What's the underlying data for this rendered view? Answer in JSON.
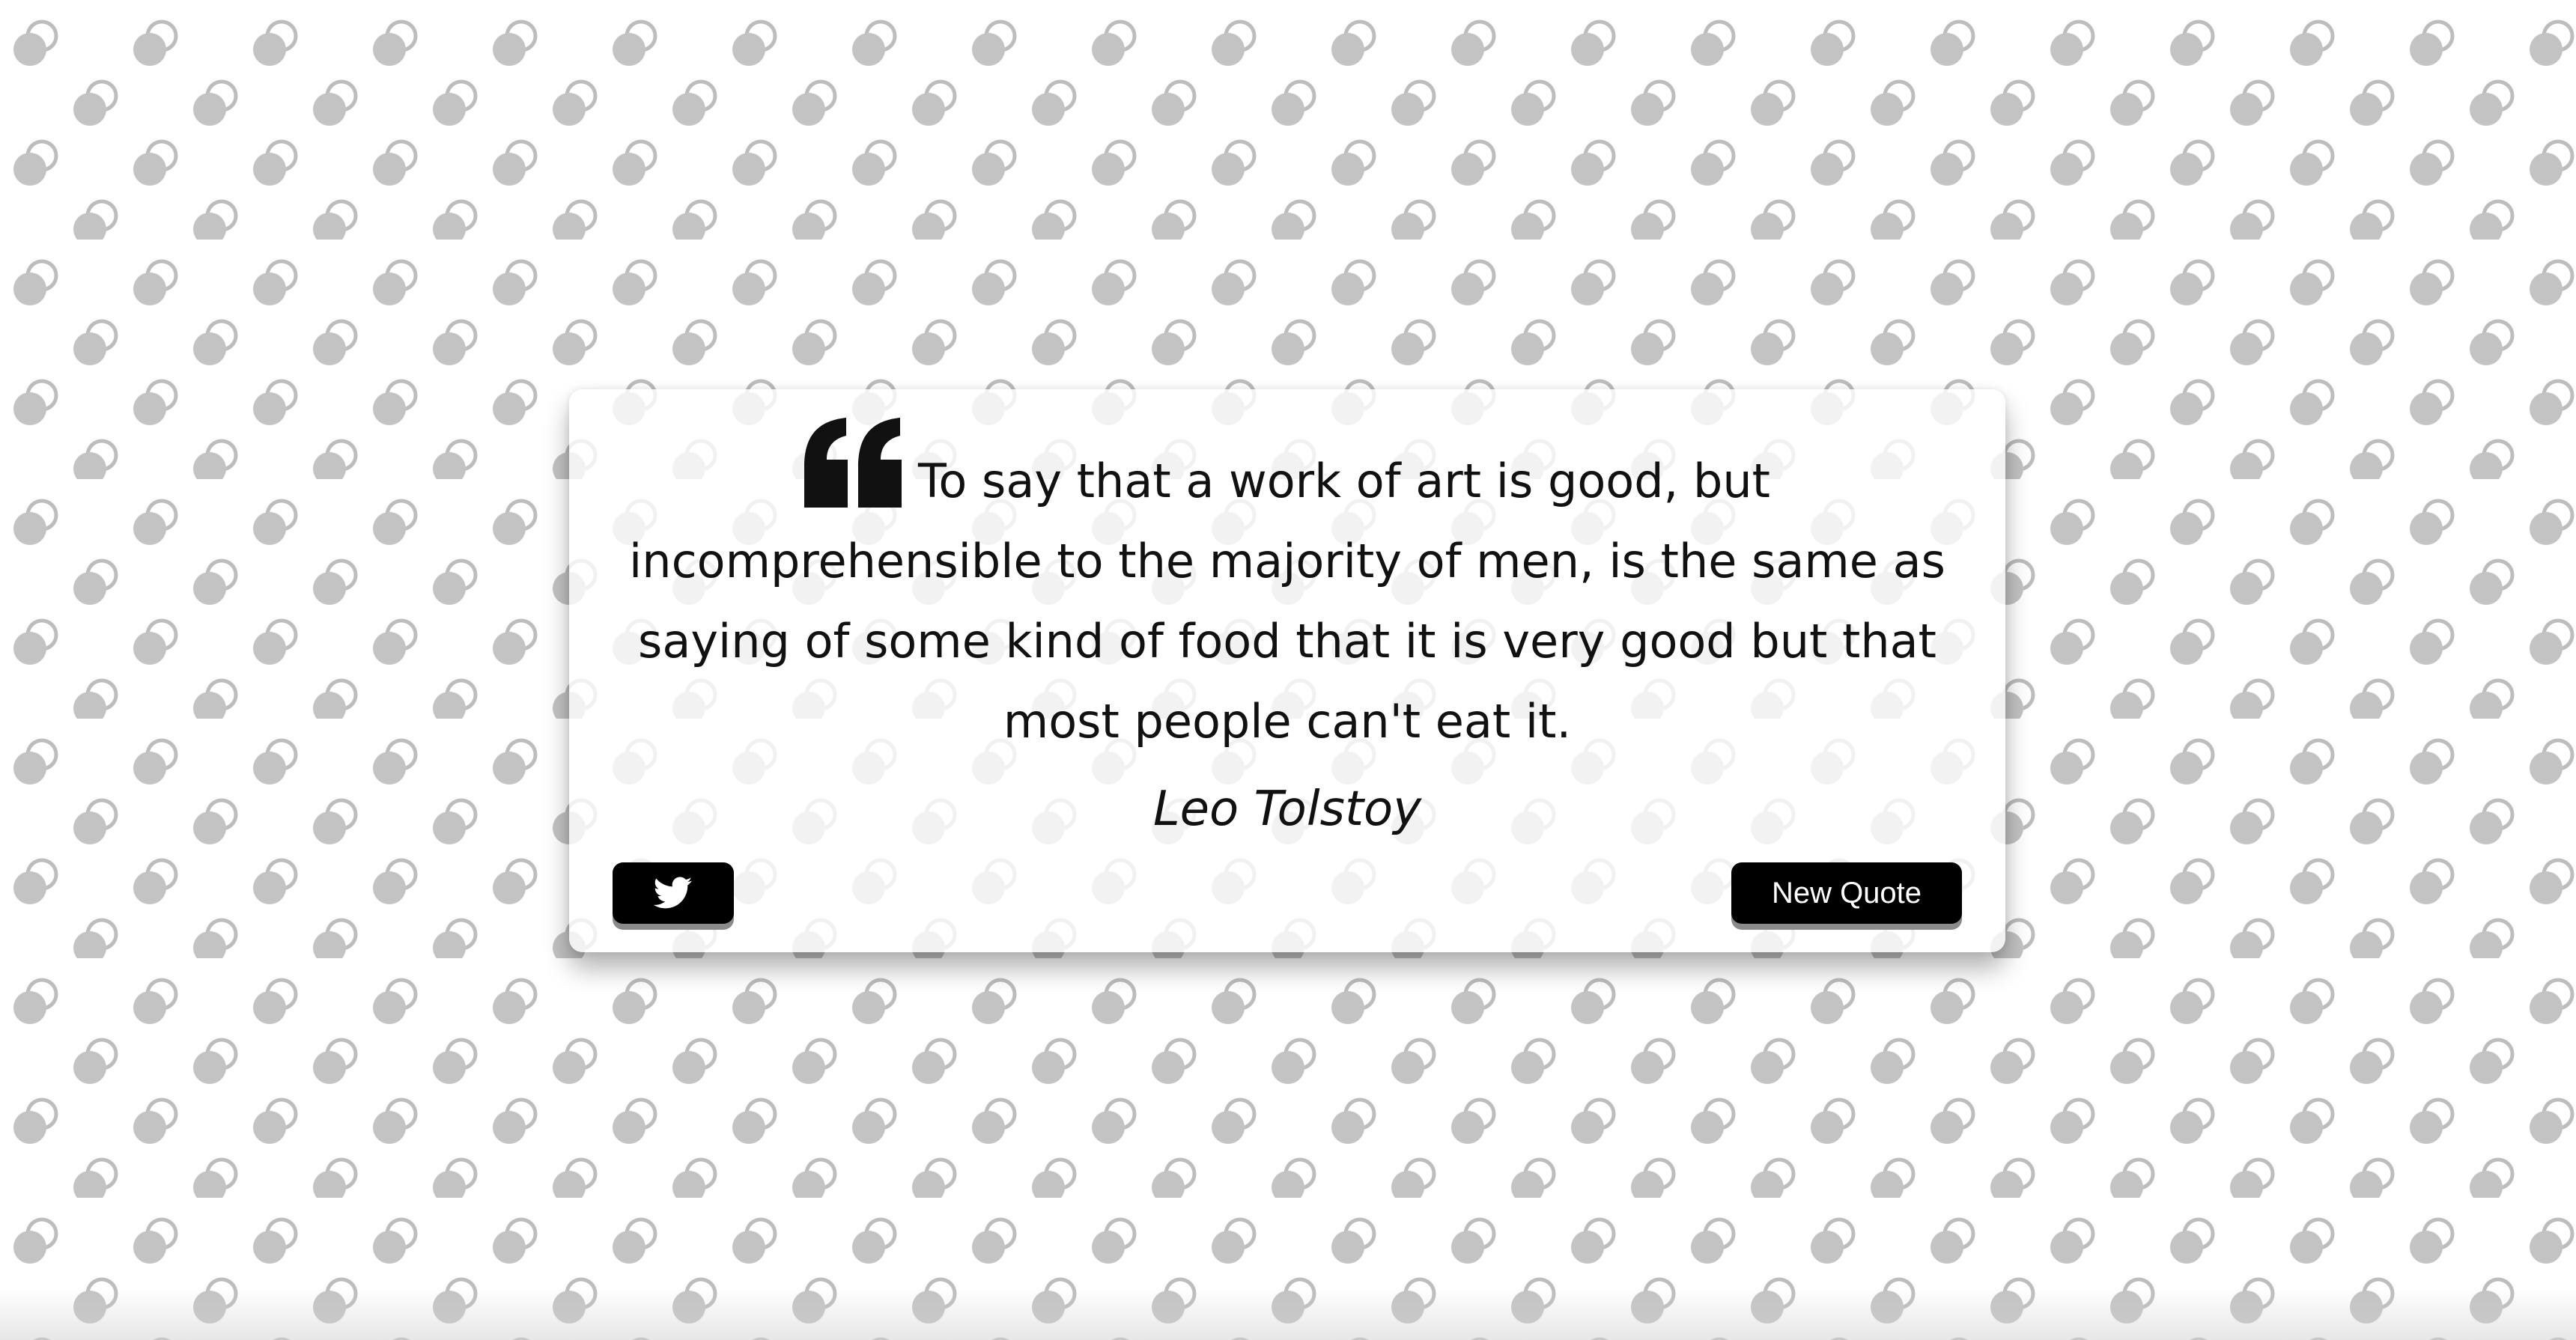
{
  "quote": {
    "text": "To say that a work of art is good, but incomprehensible to the majority of men, is the same as saying of some kind of food that it is very good but that most people can't eat it.",
    "author": "Leo Tolstoy",
    "icon": "quote-left-icon"
  },
  "buttons": {
    "tweet_icon": "twitter-icon",
    "new_quote_label": "New Quote"
  },
  "colors": {
    "background": "#ffffff",
    "pattern_fill": "#c3c3c3",
    "pattern_ring": "#bdbdbd",
    "button_bg": "#000000",
    "button_text": "#ffffff",
    "button_shadow": "#8a8a8a",
    "text": "#111111"
  }
}
